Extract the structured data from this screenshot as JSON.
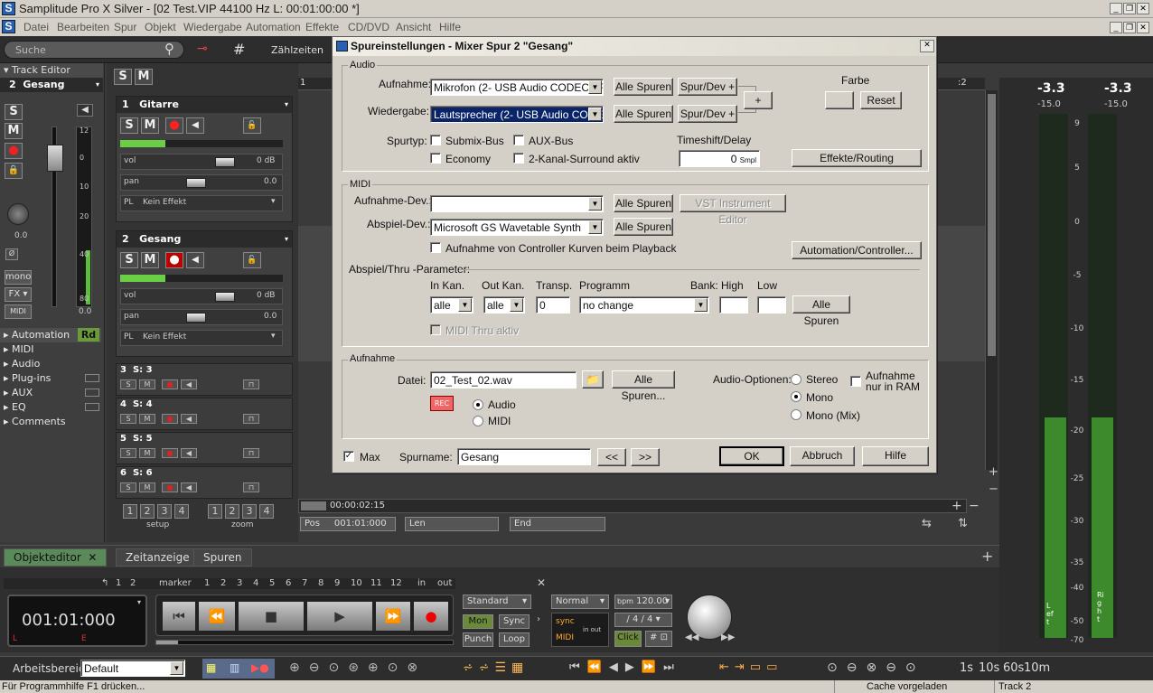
{
  "app": {
    "title": "Samplitude Pro X Silver - [02 Test.VIP    44100 Hz L: 00:01:00:00 *]",
    "menu": [
      "Datei",
      "Bearbeiten",
      "Spur",
      "Objekt",
      "Wiedergabe",
      "Automation",
      "Effekte",
      "CD/DVD",
      "Ansicht",
      "Hilfe"
    ]
  },
  "toolbar": {
    "search_placeholder": "Suche",
    "zaehlzeiten": "Zählzeiten"
  },
  "track_editor": {
    "title": "Track Editor",
    "track_number": "2",
    "track_name": "Gesang",
    "pan_value": "0.0",
    "fader_value": "0.0",
    "mono": "mono",
    "fx": "FX",
    "midi": "MIDI",
    "scale": [
      "12",
      "0",
      "10",
      "20",
      "40",
      "80"
    ],
    "sections": [
      "Automation",
      "MIDI",
      "Audio",
      "Plug-ins",
      "AUX",
      "EQ",
      "Comments"
    ],
    "automation_mode": "Rd"
  },
  "mixer": {
    "header_s": "S",
    "header_m": "M",
    "tracks_big": [
      {
        "num": "1",
        "name": "Gitarre",
        "vol": "0 dB",
        "pan": "0.0",
        "plugin": "Kein Effekt",
        "vol_label": "vol",
        "pan_label": "pan",
        "pl": "PL"
      },
      {
        "num": "2",
        "name": "Gesang",
        "vol": "0 dB",
        "pan": "0.0",
        "plugin": "Kein Effekt",
        "vol_label": "vol",
        "pan_label": "pan",
        "pl": "PL"
      }
    ],
    "tracks_small": [
      {
        "num": "3",
        "name": "S: 3"
      },
      {
        "num": "4",
        "name": "S: 4"
      },
      {
        "num": "5",
        "name": "S: 5"
      },
      {
        "num": "6",
        "name": "S: 6"
      }
    ],
    "setup_nums": [
      "1",
      "2",
      "3",
      "4"
    ],
    "zoom_nums": [
      "1",
      "2",
      "3",
      "4"
    ],
    "setup_label": "setup",
    "zoom_label": "zoom"
  },
  "arrange": {
    "marker1": "1",
    "marker2": ":2",
    "time_display": "00:00:02:15",
    "pos_label": "Pos",
    "pos_value": "001:01:000",
    "len_label": "Len",
    "end_label": "End"
  },
  "dialog": {
    "title": "Spureinstellungen - Mixer Spur 2 \"Gesang\"",
    "audio_group": "Audio",
    "aufnahme_label": "Aufnahme:",
    "aufnahme_value": "Mikrofon (2- USB Audio CODEC )-R",
    "wiedergabe_label": "Wiedergabe:",
    "wiedergabe_value": "Lautsprecher (2- USB Audio CODE",
    "alle_spuren": "Alle Spuren",
    "spur_dev": "Spur/Dev +",
    "plus": "+",
    "farbe": "Farbe",
    "reset": "Reset",
    "spurtyp_label": "Spurtyp:",
    "submix": "Submix-Bus",
    "aux_bus": "AUX-Bus",
    "economy": "Economy",
    "surround": "2-Kanal-Surround aktiv",
    "timeshift_label": "Timeshift/Delay",
    "timeshift_value": "0",
    "timeshift_unit": "Smpl",
    "effekte_routing": "Effekte/Routing",
    "midi_group": "MIDI",
    "aufnahme_dev_label": "Aufnahme-Dev.:",
    "aufnahme_dev_value": "",
    "vst_editor": "VST Instrument Editor",
    "abspiel_dev_label": "Abspiel-Dev.:",
    "abspiel_dev_value": "Microsoft GS Wavetable Synth",
    "controller_kurven": "Aufnahme von Controller Kurven beim Playback",
    "automation_controller": "Automation/Controller...",
    "thru_params": "Abspiel/Thru -Parameter:",
    "in_kan": "In Kan.",
    "out_kan": "Out Kan.",
    "transp": "Transp.",
    "programm": "Programm",
    "bank_high": "Bank: High",
    "low": "Low",
    "in_kan_value": "alle",
    "out_kan_value": "alle",
    "transp_value": "0",
    "programm_value": "no change",
    "bank_high_value": "",
    "low_value": "",
    "midi_thru": "MIDI Thru aktiv",
    "aufnahme_group": "Aufnahme",
    "datei_label": "Datei:",
    "datei_value": "02_Test_02.wav",
    "alle_spuren_dots": "Alle Spuren...",
    "rec": "REC",
    "audio_radio": "Audio",
    "midi_radio": "MIDI",
    "audio_optionen": "Audio-Optionen:",
    "stereo": "Stereo",
    "mono": "Mono",
    "mono_mix": "Mono (Mix)",
    "nur_ram_line1": "Aufnahme",
    "nur_ram_line2": "nur in RAM",
    "max": "Max",
    "spurname_label": "Spurname:",
    "spurname_value": "Gesang",
    "prev": "<<",
    "next": ">>",
    "ok": "OK",
    "abbruch": "Abbruch",
    "hilfe": "Hilfe"
  },
  "meters": {
    "peak_left": "-3.3",
    "peak_right": "-3.3",
    "rms_left": "-15.0",
    "rms_right": "-15.0",
    "scale": [
      "9",
      "5",
      "0",
      "-5",
      "-10",
      "-15",
      "-20",
      "-25",
      "-30",
      "-35",
      "-40",
      "-50",
      "-70"
    ],
    "left_label": "Left",
    "right_label": "Right",
    "level_left": 0.42,
    "level_right": 0.42
  },
  "tabs": [
    "Objekteditor",
    "Zeitanzeige",
    "Spuren"
  ],
  "transport": {
    "marker_label": "marker",
    "marker_nums": [
      "1",
      "2",
      "3",
      "4",
      "5",
      "6",
      "7",
      "8",
      "9",
      "10",
      "11",
      "12"
    ],
    "left_nums": [
      "1",
      "2"
    ],
    "in": "in",
    "out": "out",
    "time": "001:01:000",
    "l": "L",
    "e": "E",
    "standard": "Standard",
    "mon": "Mon",
    "sync": "Sync",
    "punch": "Punch",
    "loop": "Loop",
    "normal": "Normal",
    "bpm_label": "bpm",
    "bpm": "120.00",
    "signature": "4 / 4",
    "click": "Click",
    "sync_label": "sync",
    "midi_label": "MIDI",
    "in_out": "in  out"
  },
  "bottombar": {
    "arbeitsbereich_label": "Arbeitsbereich:",
    "arbeitsbereich_value": "Default",
    "zoom_values": [
      "1s",
      "10s",
      "60s",
      "10m"
    ]
  },
  "status": {
    "left": "Für Programmhilfe F1 drücken...",
    "cache": "Cache vorgeladen",
    "track": "Track 2"
  },
  "colors": {
    "meter_green": "#3d8a2c",
    "rec_red": "#c00000",
    "dialog_bg": "#d4d0c8",
    "selection": "#0a246a"
  }
}
